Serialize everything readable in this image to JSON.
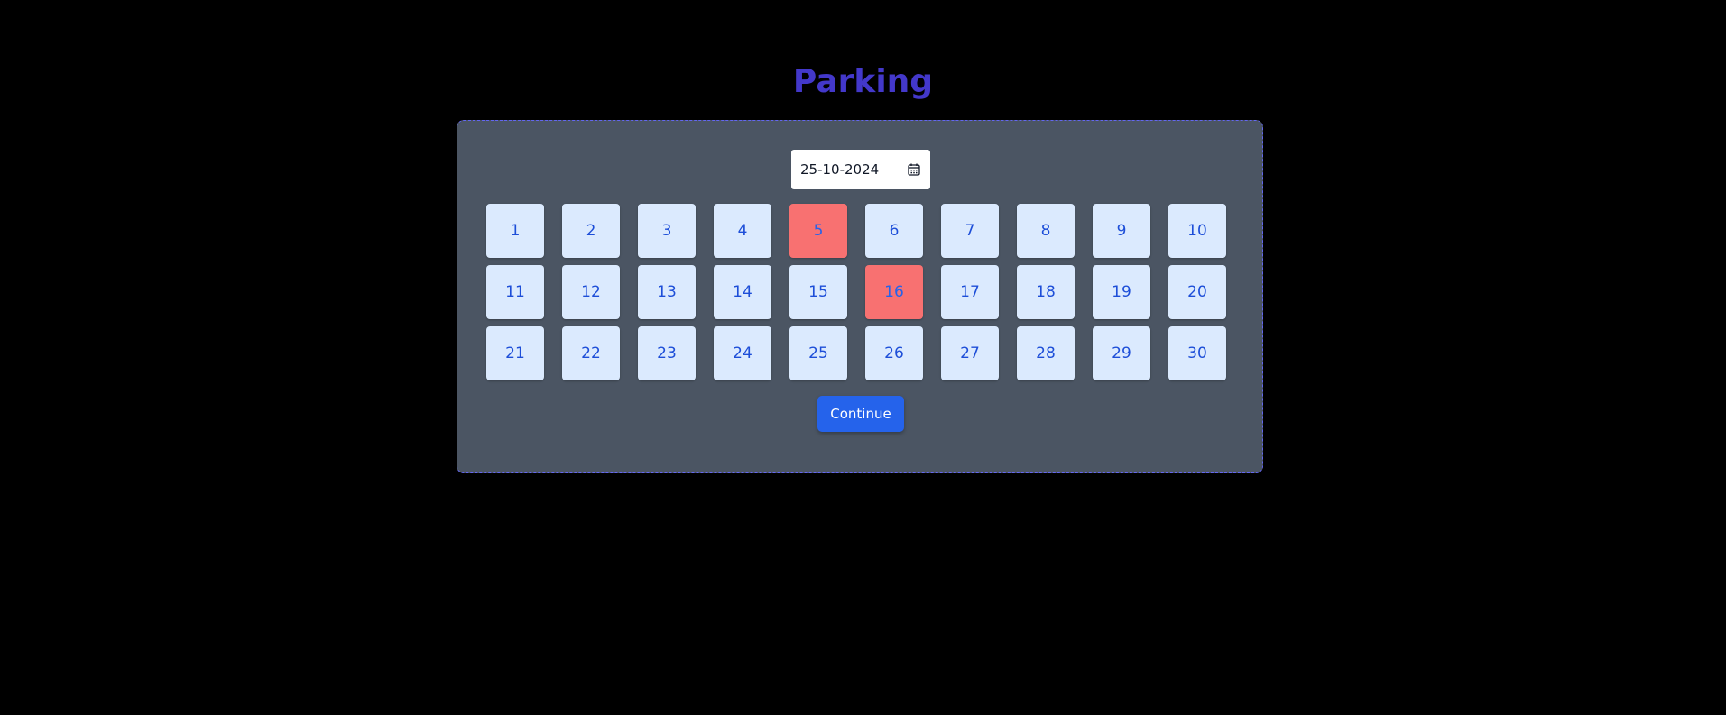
{
  "title": "Parking",
  "date_input": {
    "value": "25-10-2024",
    "icon": "calendar-icon"
  },
  "slots": [
    {
      "label": "1",
      "booked": false
    },
    {
      "label": "2",
      "booked": false
    },
    {
      "label": "3",
      "booked": false
    },
    {
      "label": "4",
      "booked": false
    },
    {
      "label": "5",
      "booked": true
    },
    {
      "label": "6",
      "booked": false
    },
    {
      "label": "7",
      "booked": false
    },
    {
      "label": "8",
      "booked": false
    },
    {
      "label": "9",
      "booked": false
    },
    {
      "label": "10",
      "booked": false
    },
    {
      "label": "11",
      "booked": false
    },
    {
      "label": "12",
      "booked": false
    },
    {
      "label": "13",
      "booked": false
    },
    {
      "label": "14",
      "booked": false
    },
    {
      "label": "15",
      "booked": false
    },
    {
      "label": "16",
      "booked": true
    },
    {
      "label": "17",
      "booked": false
    },
    {
      "label": "18",
      "booked": false
    },
    {
      "label": "19",
      "booked": false
    },
    {
      "label": "20",
      "booked": false
    },
    {
      "label": "21",
      "booked": false
    },
    {
      "label": "22",
      "booked": false
    },
    {
      "label": "23",
      "booked": false
    },
    {
      "label": "24",
      "booked": false
    },
    {
      "label": "25",
      "booked": false
    },
    {
      "label": "26",
      "booked": false
    },
    {
      "label": "27",
      "booked": false
    },
    {
      "label": "28",
      "booked": false
    },
    {
      "label": "29",
      "booked": false
    },
    {
      "label": "30",
      "booked": false
    }
  ],
  "continue_label": "Continue",
  "colors": {
    "title": "#4338ca",
    "panel": "#4b5563",
    "slot_available": "#dbeafe",
    "slot_booked": "#f87171",
    "button": "#2563eb"
  }
}
